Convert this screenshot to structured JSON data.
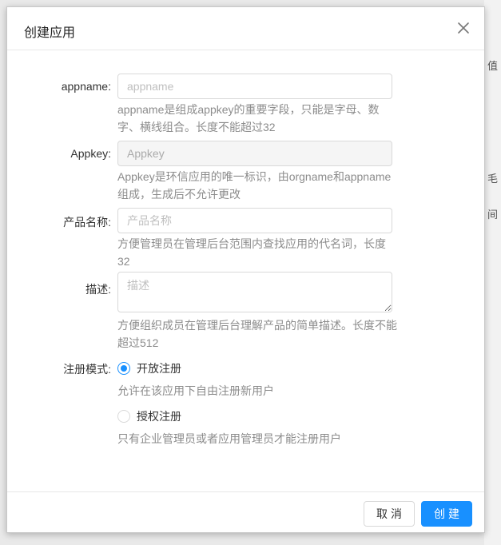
{
  "modal": {
    "title": "创建应用",
    "fields": {
      "appname": {
        "label": "appname:",
        "placeholder": "appname",
        "help": "appname是组成appkey的重要字段，只能是字母、数字、横线组合。长度不能超过32"
      },
      "appkey": {
        "label": "Appkey:",
        "placeholder": "Appkey",
        "help": "Appkey是环信应用的唯一标识，由orgname和appname组成，生成后不允许更改"
      },
      "product_name": {
        "label": "产品名称:",
        "placeholder": "产品名称",
        "help": "方便管理员在管理后台范围内查找应用的代名词，长度32"
      },
      "description": {
        "label": "描述:",
        "placeholder": "描述",
        "help": "方便组织成员在管理后台理解产品的简单描述。长度不能超过512"
      },
      "registration_mode": {
        "label": "注册模式:",
        "options": [
          {
            "label": "开放注册",
            "help": "允许在该应用下自由注册新用户",
            "checked": true
          },
          {
            "label": "授权注册",
            "help": "只有企业管理员或者应用管理员才能注册用户",
            "checked": false
          }
        ]
      }
    },
    "footer": {
      "cancel_label": "取消",
      "submit_label": "创建"
    }
  },
  "backdrop": {
    "fragments": [
      "值",
      "毛",
      "间"
    ]
  },
  "colors": {
    "primary": "#1890ff",
    "border": "#d9d9d9",
    "help_text": "#8c8c8c"
  },
  "icons": {
    "close": "close-icon"
  }
}
